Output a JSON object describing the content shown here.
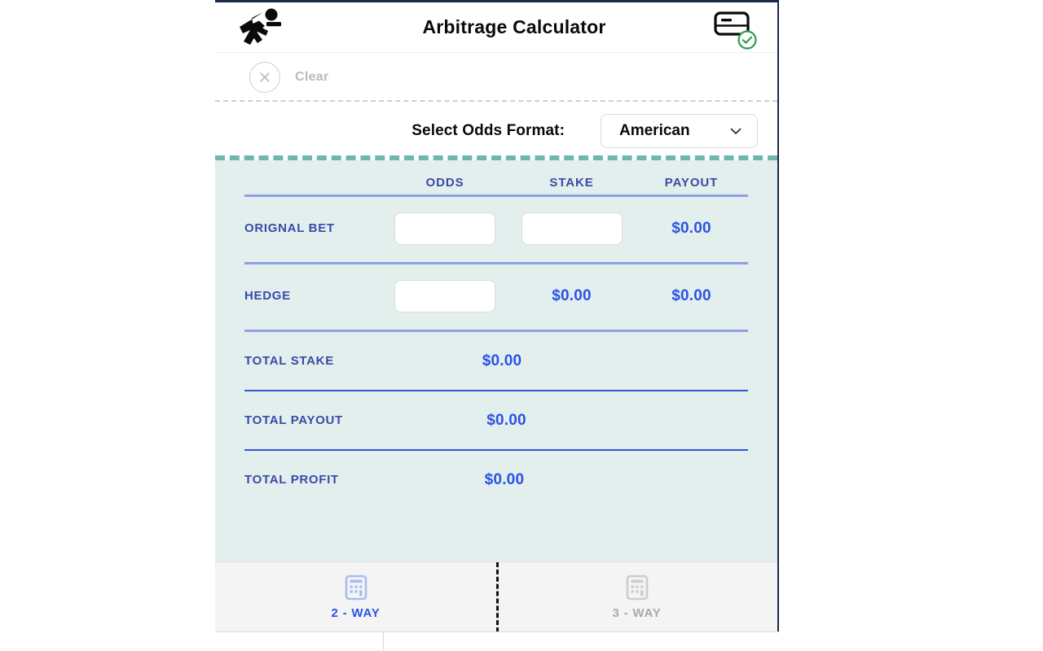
{
  "header": {
    "title": "Arbitrage Calculator",
    "logo_icon": "running-person-icon",
    "wallet_icon": "card-icon",
    "verified_icon": "check-circle-icon"
  },
  "toolbar": {
    "clear_label": "Clear",
    "clear_icon": "close-circle-icon"
  },
  "odds_format": {
    "label": "Select Odds Format:",
    "selected": "American",
    "chevron_icon": "chevron-down-icon"
  },
  "calculator": {
    "columns": [
      "ODDS",
      "STAKE",
      "PAYOUT"
    ],
    "rows": [
      {
        "label": "ORIGNAL BET",
        "odds_value": "",
        "odds_placeholder": "",
        "stake_value": "",
        "stake_placeholder": "",
        "payout": "$0.00"
      },
      {
        "label": "HEDGE",
        "odds_value": "",
        "odds_placeholder": "",
        "stake": "$0.00",
        "payout": "$0.00"
      }
    ],
    "totals": [
      {
        "label": "TOTAL STAKE",
        "value": "$0.00"
      },
      {
        "label": "TOTAL PAYOUT",
        "value": "$0.00"
      },
      {
        "label": "TOTAL PROFIT",
        "value": "$0.00"
      }
    ]
  },
  "tabs": [
    {
      "label": "2 - WAY",
      "icon": "calculator-icon",
      "active": true
    },
    {
      "label": "3 - WAY",
      "icon": "calculator-icon",
      "active": false
    }
  ],
  "colors": {
    "accent_blue": "#2b52e8",
    "label_blue": "#3a4aa8",
    "panel_mint": "#e3efed",
    "dashed_teal": "#6fb7ad",
    "header_dark": "#1c2b4a",
    "muted_gray": "#b9b9b9",
    "verified_green": "#2e9e4f"
  }
}
